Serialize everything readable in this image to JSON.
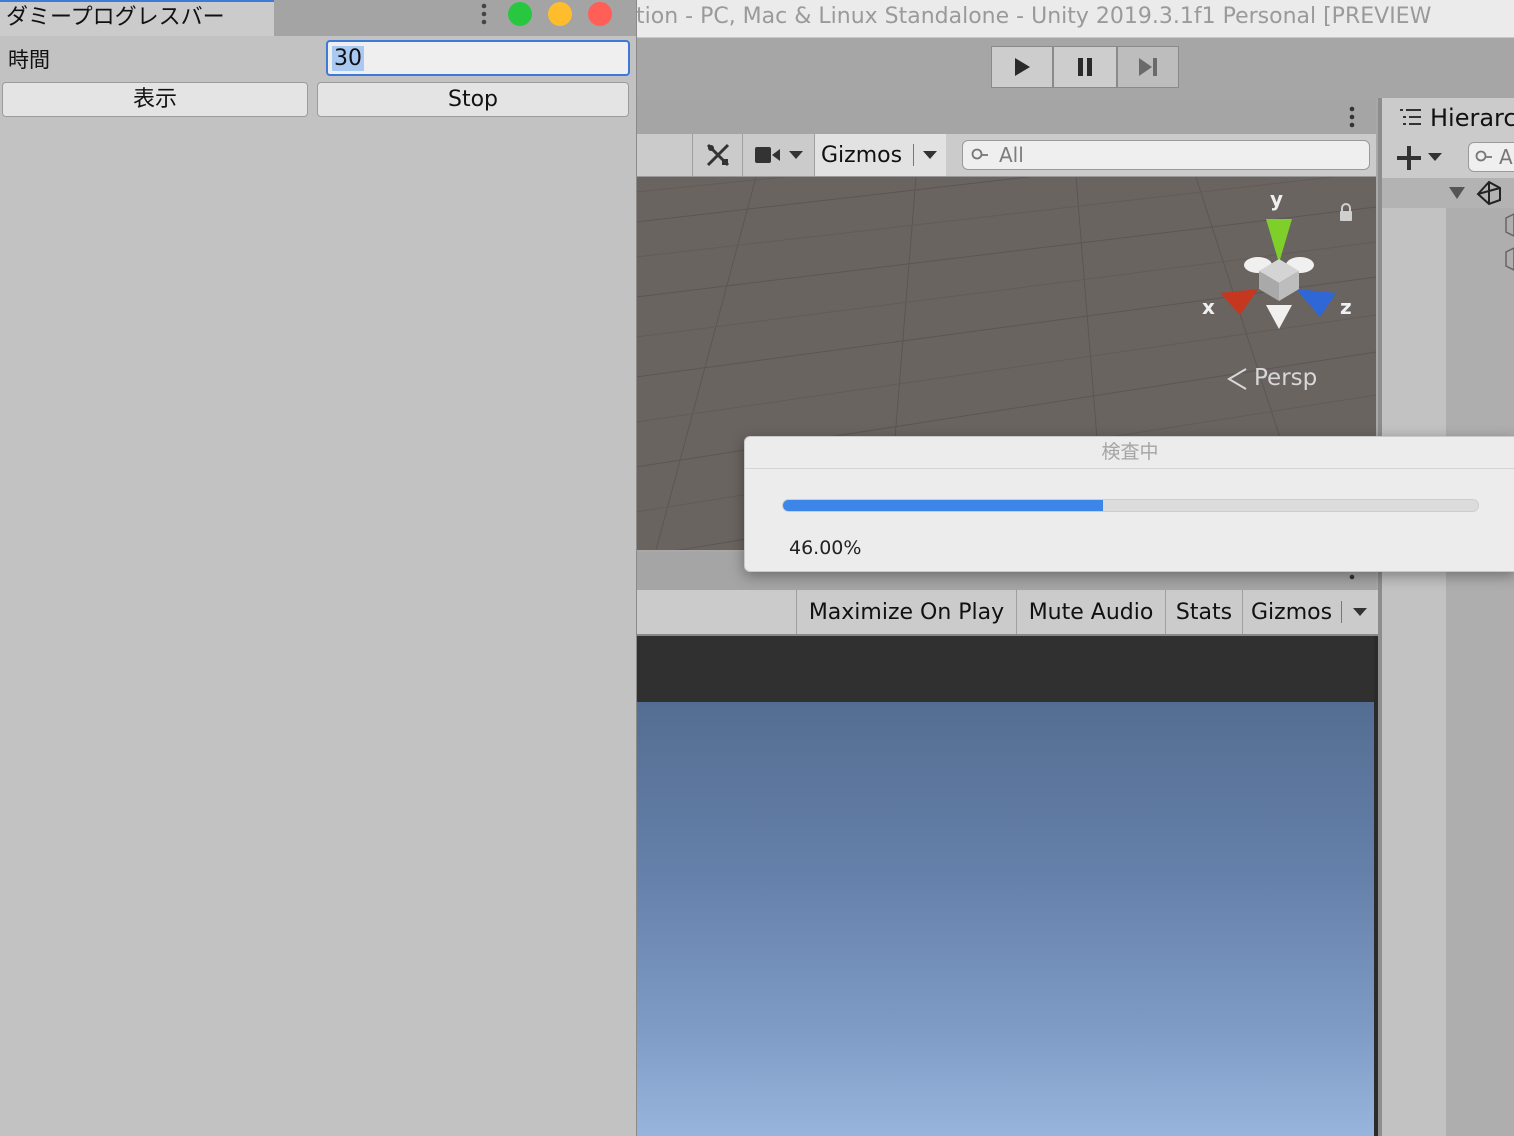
{
  "unity": {
    "title": "tion - PC, Mac & Linux Standalone - Unity 2019.3.1f1 Personal [PREVIEW",
    "play_icons": [
      "play-icon",
      "pause-icon",
      "step-icon"
    ],
    "scene": {
      "gizmos_label": "Gizmos",
      "search_placeholder": "All",
      "axis_y": "y",
      "axis_x": "x",
      "axis_z": "z",
      "persp_label": "Persp"
    },
    "game": {
      "maximize_label": "Maximize On Play",
      "mute_label": "Mute Audio",
      "stats_label": "Stats",
      "gizmos_label": "Gizmos"
    },
    "hierarchy": {
      "tab_label": "Hierarc",
      "search_fragment": "A"
    }
  },
  "progress_dialog": {
    "title": "検査中",
    "percent_text": "46.00%",
    "progress_fraction": 0.46,
    "fill_color": "#3b86e8"
  },
  "editor_window": {
    "tab_title": "ダミープログレスバー",
    "field_label": "時間",
    "field_value": "30",
    "show_button_label": "表示",
    "stop_button_label": "Stop",
    "traffic_colors": {
      "zoom": "#27c840",
      "minimize": "#ffbd2e",
      "close": "#ff5f57"
    }
  }
}
